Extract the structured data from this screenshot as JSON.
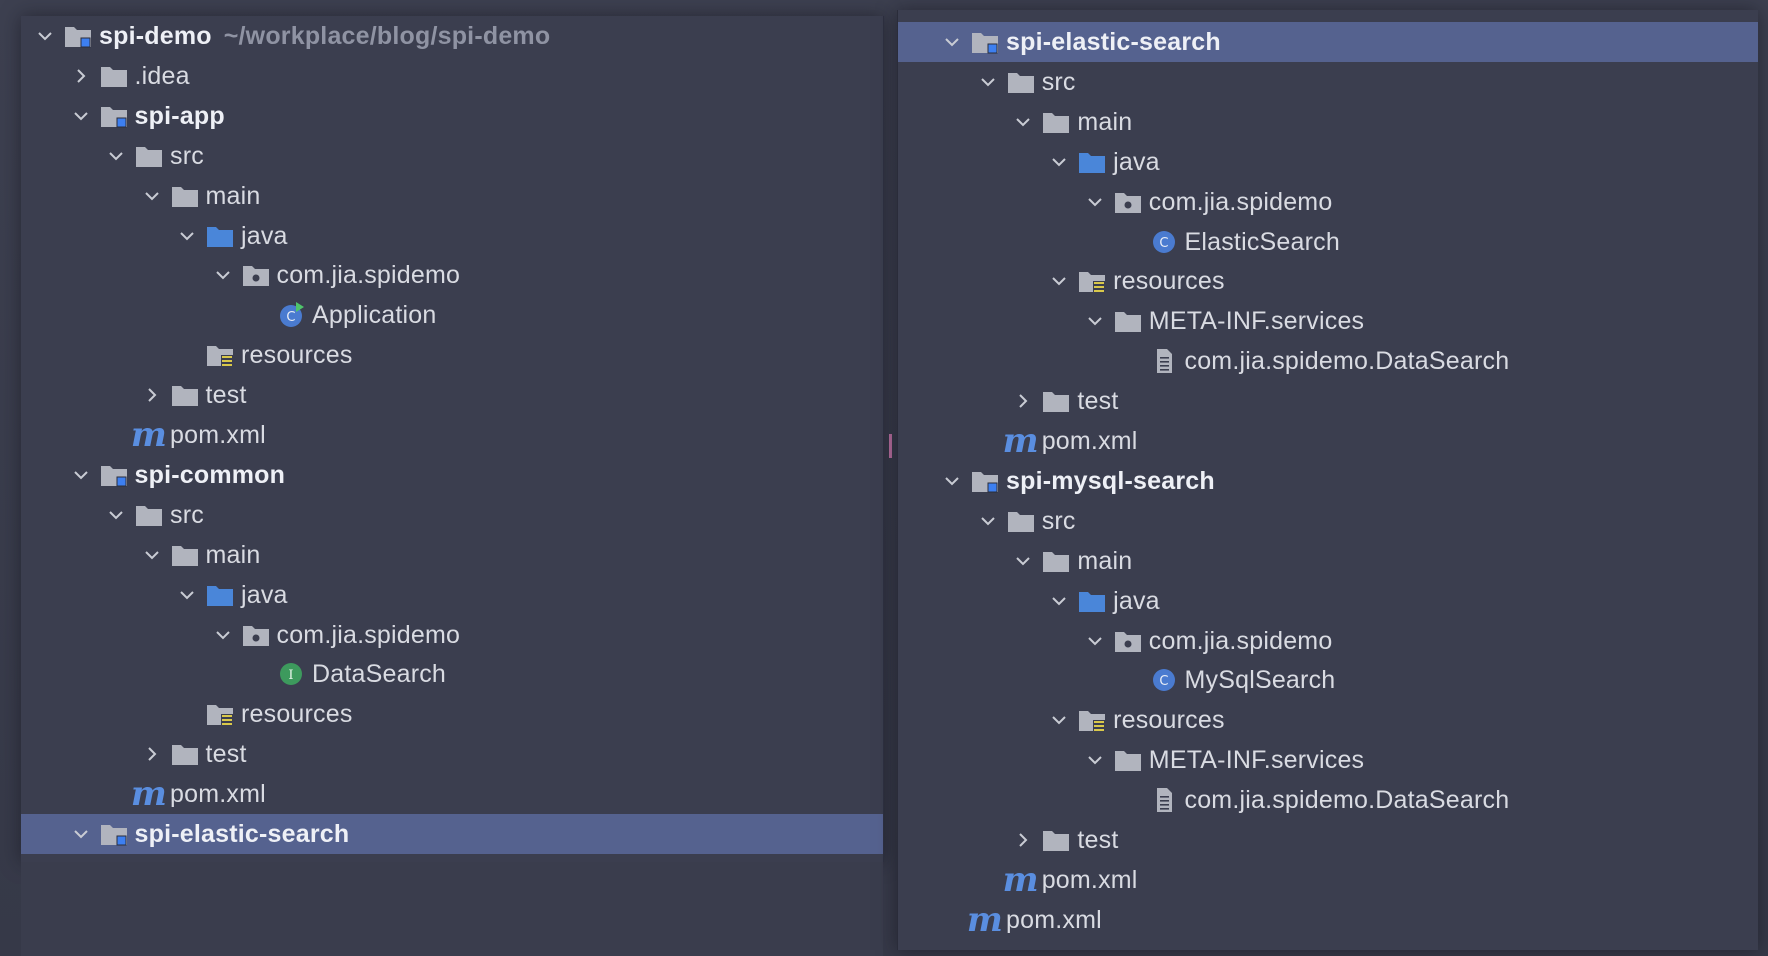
{
  "left_panel": {
    "root": {
      "label": "spi-demo",
      "path": "~/workplace/blog/spi-demo"
    },
    "rows": [
      {
        "label": "spi-demo",
        "indent": 0,
        "chevron": "down",
        "icon": "module-folder-icon",
        "bold": true
      },
      {
        "label": ".idea",
        "indent": 1,
        "chevron": "right",
        "icon": "folder-icon"
      },
      {
        "label": "spi-app",
        "indent": 1,
        "chevron": "down",
        "icon": "module-folder-icon",
        "bold": true
      },
      {
        "label": "src",
        "indent": 2,
        "chevron": "down",
        "icon": "folder-icon"
      },
      {
        "label": "main",
        "indent": 3,
        "chevron": "down",
        "icon": "folder-icon"
      },
      {
        "label": "java",
        "indent": 4,
        "chevron": "down",
        "icon": "source-folder-icon"
      },
      {
        "label": "com.jia.spidemo",
        "indent": 5,
        "chevron": "down",
        "icon": "package-icon"
      },
      {
        "label": "Application",
        "indent": 6,
        "chevron": "",
        "icon": "runnable-class-icon"
      },
      {
        "label": "resources",
        "indent": 4,
        "chevron": "",
        "icon": "resources-folder-icon"
      },
      {
        "label": "test",
        "indent": 3,
        "chevron": "right",
        "icon": "folder-icon"
      },
      {
        "label": "pom.xml",
        "indent": 2,
        "chevron": "",
        "icon": "maven-icon"
      },
      {
        "label": "spi-common",
        "indent": 1,
        "chevron": "down",
        "icon": "module-folder-icon",
        "bold": true
      },
      {
        "label": "src",
        "indent": 2,
        "chevron": "down",
        "icon": "folder-icon"
      },
      {
        "label": "main",
        "indent": 3,
        "chevron": "down",
        "icon": "folder-icon"
      },
      {
        "label": "java",
        "indent": 4,
        "chevron": "down",
        "icon": "source-folder-icon"
      },
      {
        "label": "com.jia.spidemo",
        "indent": 5,
        "chevron": "down",
        "icon": "package-icon"
      },
      {
        "label": "DataSearch",
        "indent": 6,
        "chevron": "",
        "icon": "interface-icon"
      },
      {
        "label": "resources",
        "indent": 4,
        "chevron": "",
        "icon": "resources-folder-icon"
      },
      {
        "label": "test",
        "indent": 3,
        "chevron": "right",
        "icon": "folder-icon"
      },
      {
        "label": "pom.xml",
        "indent": 2,
        "chevron": "",
        "icon": "maven-icon"
      },
      {
        "label": "spi-elastic-search",
        "indent": 1,
        "chevron": "down",
        "icon": "module-folder-icon",
        "bold": true,
        "selected": true
      }
    ]
  },
  "right_panel": {
    "rows": [
      {
        "label": "spi-elastic-search",
        "indent": 0,
        "chevron": "down",
        "icon": "module-folder-icon",
        "bold": true,
        "selected": true
      },
      {
        "label": "src",
        "indent": 1,
        "chevron": "down",
        "icon": "folder-icon"
      },
      {
        "label": "main",
        "indent": 2,
        "chevron": "down",
        "icon": "folder-icon"
      },
      {
        "label": "java",
        "indent": 3,
        "chevron": "down",
        "icon": "source-folder-icon"
      },
      {
        "label": "com.jia.spidemo",
        "indent": 4,
        "chevron": "down",
        "icon": "package-icon"
      },
      {
        "label": "ElasticSearch",
        "indent": 5,
        "chevron": "",
        "icon": "class-icon"
      },
      {
        "label": "resources",
        "indent": 3,
        "chevron": "down",
        "icon": "resources-folder-icon"
      },
      {
        "label": "META-INF.services",
        "indent": 4,
        "chevron": "down",
        "icon": "folder-icon"
      },
      {
        "label": "com.jia.spidemo.DataSearch",
        "indent": 5,
        "chevron": "",
        "icon": "text-file-icon"
      },
      {
        "label": "test",
        "indent": 2,
        "chevron": "right",
        "icon": "folder-icon"
      },
      {
        "label": "pom.xml",
        "indent": 1,
        "chevron": "",
        "icon": "maven-icon"
      },
      {
        "label": "spi-mysql-search",
        "indent": 0,
        "chevron": "down",
        "icon": "module-folder-icon",
        "bold": true
      },
      {
        "label": "src",
        "indent": 1,
        "chevron": "down",
        "icon": "folder-icon"
      },
      {
        "label": "main",
        "indent": 2,
        "chevron": "down",
        "icon": "folder-icon"
      },
      {
        "label": "java",
        "indent": 3,
        "chevron": "down",
        "icon": "source-folder-icon"
      },
      {
        "label": "com.jia.spidemo",
        "indent": 4,
        "chevron": "down",
        "icon": "package-icon"
      },
      {
        "label": "MySqlSearch",
        "indent": 5,
        "chevron": "",
        "icon": "class-icon"
      },
      {
        "label": "resources",
        "indent": 3,
        "chevron": "down",
        "icon": "resources-folder-icon"
      },
      {
        "label": "META-INF.services",
        "indent": 4,
        "chevron": "down",
        "icon": "folder-icon"
      },
      {
        "label": "com.jia.spidemo.DataSearch",
        "indent": 5,
        "chevron": "",
        "icon": "text-file-icon"
      },
      {
        "label": "test",
        "indent": 2,
        "chevron": "right",
        "icon": "folder-icon"
      },
      {
        "label": "pom.xml",
        "indent": 1,
        "chevron": "",
        "icon": "maven-icon"
      },
      {
        "label": "pom.xml",
        "indent": 0,
        "chevron": "",
        "icon": "maven-icon"
      }
    ]
  },
  "icons": {
    "maven_glyph": "m",
    "class_glyph": "C",
    "interface_glyph": "I"
  },
  "colors": {
    "background": "#3b3e4f",
    "selection": "#55628f",
    "text": "#d9dbe2",
    "folder": "#b3b6c0",
    "source_folder": "#4a86d9",
    "class_badge": "#4a7bd0",
    "interface_badge": "#3d9a5d",
    "maven": "#5a8ee0",
    "resources_marker": "#d9c84a",
    "run_marker": "#4fc46b"
  }
}
